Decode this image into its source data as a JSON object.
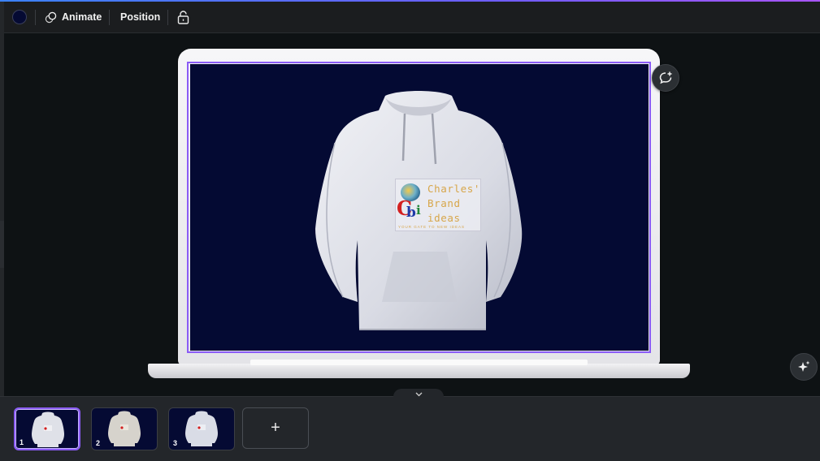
{
  "toolbar": {
    "color_swatch": "#050a33",
    "animate_label": "Animate",
    "position_label": "Position",
    "icons": [
      "animate-icon",
      "lock-icon"
    ]
  },
  "design": {
    "background_color": "#040a33",
    "mockup": "laptop",
    "logo": {
      "line1": "Charles'",
      "line2": "Brand",
      "line3": "ideas",
      "tagline": "YOUR GATE TO NEW IDEAS",
      "mark_c": "C",
      "mark_b": "b",
      "mark_i": "i"
    }
  },
  "pages": {
    "thumbnails": [
      {
        "number": "1",
        "active": true
      },
      {
        "number": "2",
        "active": false
      },
      {
        "number": "3",
        "active": false
      }
    ],
    "add_label": "+"
  },
  "colors": {
    "accent": "#8b5cf6",
    "toolbar_bg": "#1b1d1f",
    "canvas_bg": "#0e1214",
    "logo_gold": "#d7a64a"
  }
}
